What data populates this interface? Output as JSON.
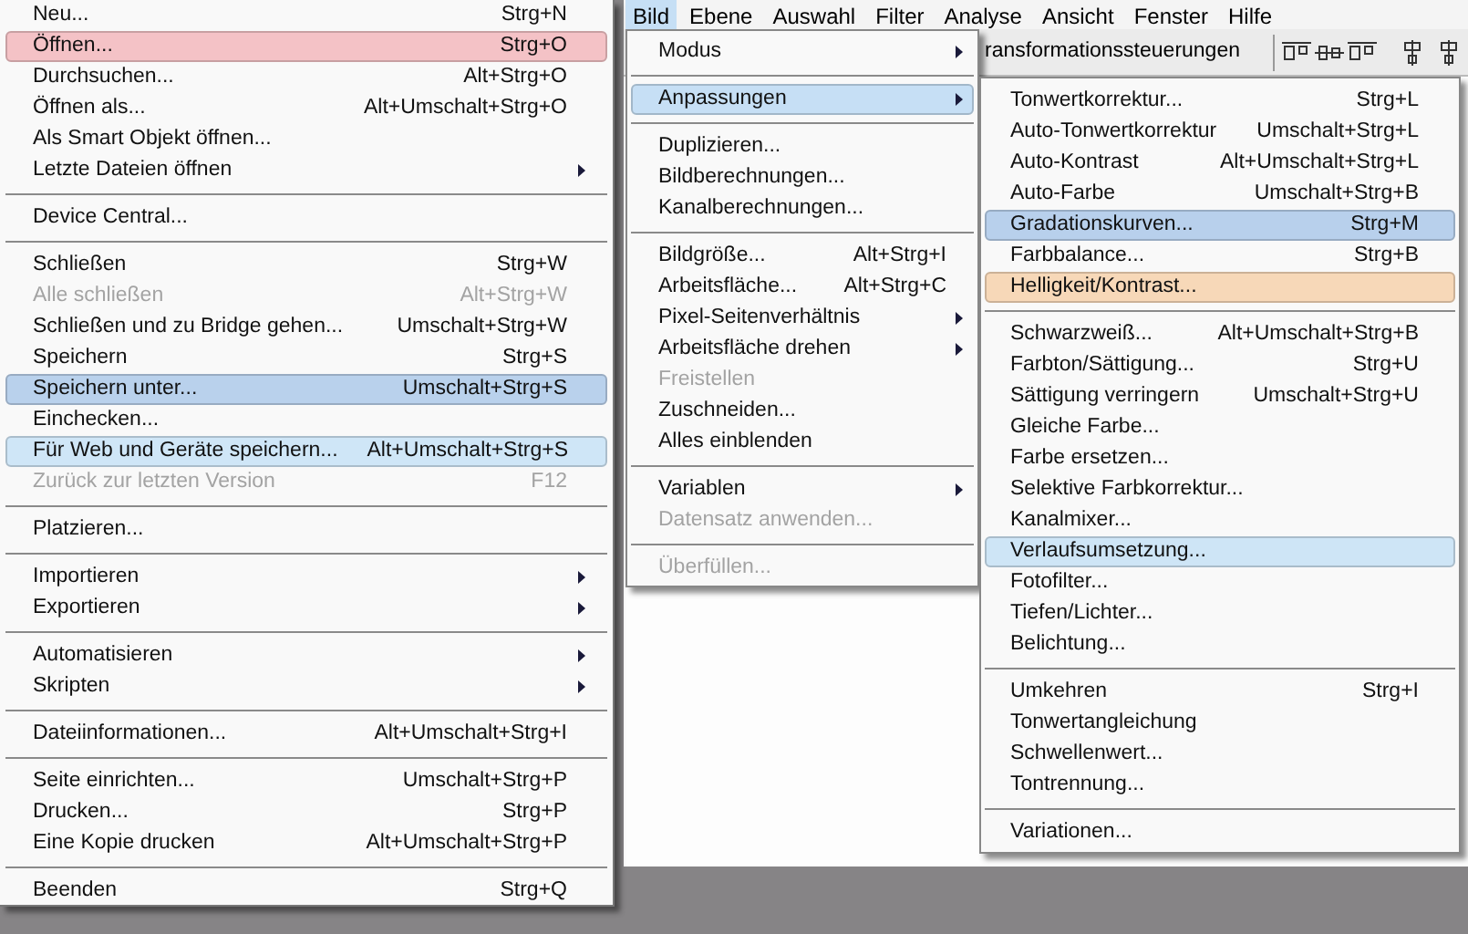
{
  "file_menu": {
    "sections": [
      {
        "items": [
          {
            "label": "Neu...",
            "shortcut": "Strg+N",
            "disabled": false
          },
          {
            "label": "Öffnen...",
            "shortcut": "Strg+O",
            "disabled": false,
            "color": "#f4c2c6"
          },
          {
            "label": "Durchsuchen...",
            "shortcut": "Alt+Strg+O",
            "disabled": false
          },
          {
            "label": "Öffnen als...",
            "shortcut": "Alt+Umschalt+Strg+O",
            "disabled": false
          },
          {
            "label": "Als Smart Objekt öffnen...",
            "disabled": false
          },
          {
            "label": "Letzte Dateien öffnen",
            "submenu": true,
            "disabled": false
          }
        ]
      },
      {
        "items": [
          {
            "label": "Device Central...",
            "disabled": false
          }
        ]
      },
      {
        "items": [
          {
            "label": "Schließen",
            "shortcut": "Strg+W",
            "disabled": false
          },
          {
            "label": "Alle schließen",
            "shortcut": "Alt+Strg+W",
            "disabled": true
          },
          {
            "label": "Schließen und zu Bridge gehen...",
            "shortcut": "Umschalt+Strg+W",
            "disabled": false
          },
          {
            "label": "Speichern",
            "shortcut": "Strg+S",
            "disabled": false
          },
          {
            "label": "Speichern unter...",
            "shortcut": "Umschalt+Strg+S",
            "disabled": false,
            "color": "#b9d1ec"
          },
          {
            "label": "Einchecken...",
            "disabled": false
          },
          {
            "label": "Für Web und Geräte speichern...",
            "shortcut": "Alt+Umschalt+Strg+S",
            "disabled": false,
            "color": "#cfe6f7"
          },
          {
            "label": "Zurück zur letzten Version",
            "shortcut": "F12",
            "disabled": true
          }
        ]
      },
      {
        "items": [
          {
            "label": "Platzieren...",
            "disabled": false
          }
        ]
      },
      {
        "items": [
          {
            "label": "Importieren",
            "submenu": true,
            "disabled": false
          },
          {
            "label": "Exportieren",
            "submenu": true,
            "disabled": false
          }
        ]
      },
      {
        "items": [
          {
            "label": "Automatisieren",
            "submenu": true,
            "disabled": false
          },
          {
            "label": "Skripten",
            "submenu": true,
            "disabled": false
          }
        ]
      },
      {
        "items": [
          {
            "label": "Dateiinformationen...",
            "shortcut": "Alt+Umschalt+Strg+I",
            "disabled": false
          }
        ]
      },
      {
        "items": [
          {
            "label": "Seite einrichten...",
            "shortcut": "Umschalt+Strg+P",
            "disabled": false
          },
          {
            "label": "Drucken...",
            "shortcut": "Strg+P",
            "disabled": false
          },
          {
            "label": "Eine Kopie drucken",
            "shortcut": "Alt+Umschalt+Strg+P",
            "disabled": false
          }
        ]
      },
      {
        "items": [
          {
            "label": "Beenden",
            "shortcut": "Strg+Q",
            "disabled": false
          }
        ]
      }
    ]
  },
  "menu_bar": [
    {
      "label": "Bild",
      "selected": true
    },
    {
      "label": "Ebene",
      "selected": false
    },
    {
      "label": "Auswahl",
      "selected": false
    },
    {
      "label": "Filter",
      "selected": false
    },
    {
      "label": "Analyse",
      "selected": false
    },
    {
      "label": "Ansicht",
      "selected": false
    },
    {
      "label": "Fenster",
      "selected": false
    },
    {
      "label": "Hilfe",
      "selected": false
    }
  ],
  "options_bar": {
    "label": "ransformationssteuerungen"
  },
  "image_menu": {
    "sections": [
      {
        "items": [
          {
            "label": "Modus",
            "submenu": true,
            "disabled": false
          }
        ]
      },
      {
        "items": [
          {
            "label": "Anpassungen",
            "submenu": true,
            "disabled": false,
            "color": "#c6dff5"
          }
        ]
      },
      {
        "items": [
          {
            "label": "Duplizieren...",
            "disabled": false
          },
          {
            "label": "Bildberechnungen...",
            "disabled": false
          },
          {
            "label": "Kanalberechnungen...",
            "disabled": false
          }
        ]
      },
      {
        "items": [
          {
            "label": "Bildgröße...",
            "shortcut": "Alt+Strg+I",
            "disabled": false
          },
          {
            "label": "Arbeitsfläche...",
            "shortcut": "Alt+Strg+C",
            "disabled": false
          },
          {
            "label": "Pixel-Seitenverhältnis",
            "submenu": true,
            "disabled": false
          },
          {
            "label": "Arbeitsfläche drehen",
            "submenu": true,
            "disabled": false
          },
          {
            "label": "Freistellen",
            "disabled": true
          },
          {
            "label": "Zuschneiden...",
            "disabled": false
          },
          {
            "label": "Alles einblenden",
            "disabled": false
          }
        ]
      },
      {
        "items": [
          {
            "label": "Variablen",
            "submenu": true,
            "disabled": false
          },
          {
            "label": "Datensatz anwenden...",
            "disabled": true
          }
        ]
      },
      {
        "items": [
          {
            "label": "Überfüllen...",
            "disabled": true
          }
        ]
      }
    ]
  },
  "adjustments_menu": {
    "sections": [
      {
        "items": [
          {
            "label": "Tonwertkorrektur...",
            "shortcut": "Strg+L",
            "disabled": false
          },
          {
            "label": "Auto-Tonwertkorrektur",
            "shortcut": "Umschalt+Strg+L",
            "disabled": false
          },
          {
            "label": "Auto-Kontrast",
            "shortcut": "Alt+Umschalt+Strg+L",
            "disabled": false
          },
          {
            "label": "Auto-Farbe",
            "shortcut": "Umschalt+Strg+B",
            "disabled": false
          },
          {
            "label": "Gradationskurven...",
            "shortcut": "Strg+M",
            "disabled": false,
            "color": "#b8d0ec"
          },
          {
            "label": "Farbbalance...",
            "shortcut": "Strg+B",
            "disabled": false
          },
          {
            "label": "Helligkeit/Kontrast...",
            "disabled": false,
            "color": "#f7d8b8"
          }
        ]
      },
      {
        "items": [
          {
            "label": "Schwarzweiß...",
            "shortcut": "Alt+Umschalt+Strg+B",
            "disabled": false
          },
          {
            "label": "Farbton/Sättigung...",
            "shortcut": "Strg+U",
            "disabled": false
          },
          {
            "label": "Sättigung verringern",
            "shortcut": "Umschalt+Strg+U",
            "disabled": false
          },
          {
            "label": "Gleiche Farbe...",
            "disabled": false
          },
          {
            "label": "Farbe ersetzen...",
            "disabled": false
          },
          {
            "label": "Selektive Farbkorrektur...",
            "disabled": false
          },
          {
            "label": "Kanalmixer...",
            "disabled": false
          },
          {
            "label": "Verlaufsumsetzung...",
            "disabled": false,
            "color": "#cee5f6"
          },
          {
            "label": "Fotofilter...",
            "disabled": false
          },
          {
            "label": "Tiefen/Lichter...",
            "disabled": false
          },
          {
            "label": "Belichtung...",
            "disabled": false
          }
        ]
      },
      {
        "items": [
          {
            "label": "Umkehren",
            "shortcut": "Strg+I",
            "disabled": false
          },
          {
            "label": "Tonwertangleichung",
            "disabled": false
          },
          {
            "label": "Schwellenwert...",
            "disabled": false
          },
          {
            "label": "Tontrennung...",
            "disabled": false
          }
        ]
      },
      {
        "items": [
          {
            "label": "Variationen...",
            "disabled": false
          }
        ]
      }
    ]
  }
}
